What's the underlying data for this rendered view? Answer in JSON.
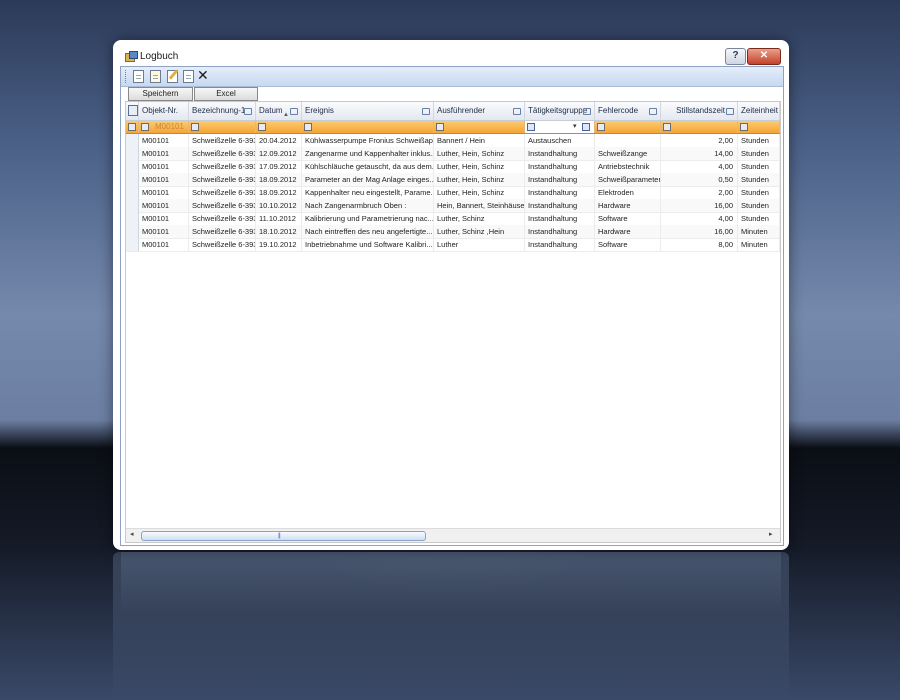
{
  "window": {
    "title": "Logbuch",
    "help_label": "?",
    "close_label": "✕"
  },
  "toolbar": {
    "icons": [
      "new-document-icon",
      "open-document-icon",
      "edit-document-icon",
      "blank-document-icon",
      "delete-icon"
    ],
    "delete_glyph": "✕"
  },
  "buttons": {
    "save_label": "Speichern",
    "excel_label": "Excel"
  },
  "grid": {
    "columns": [
      {
        "label": "Objekt-Nr."
      },
      {
        "label": "Bezeichnung-1"
      },
      {
        "label": "Datum"
      },
      {
        "label": "Ereignis"
      },
      {
        "label": "Ausführender"
      },
      {
        "label": "Tätigkeitsgruppe"
      },
      {
        "label": "Fehlercode"
      },
      {
        "label": "Stillstandszeit"
      },
      {
        "label": "Zeiteinheit"
      }
    ],
    "filter_ghost_text": "M00101",
    "rows": [
      {
        "objekt": "M00101",
        "bez": "Schweißzelle 6-393",
        "datum": "20.04.2012",
        "ereignis": "Kühlwasserpumpe Fronius Schweißap...",
        "ausf": "Bannert / Hein",
        "gruppe": "Austauschen",
        "fehler": "",
        "zeit": "2,00",
        "einheit": "Stunden"
      },
      {
        "objekt": "M00101",
        "bez": "Schweißzelle 6-393",
        "datum": "12.09.2012",
        "ereignis": "Zangenarme und Kappenhalter inklus...",
        "ausf": "Luther, Hein, Schinz",
        "gruppe": "Instandhaltung",
        "fehler": "Schweißzange",
        "zeit": "14,00",
        "einheit": "Stunden"
      },
      {
        "objekt": "M00101",
        "bez": "Schweißzelle 6-393",
        "datum": "17.09.2012",
        "ereignis": "Kühlschläuche getauscht, da aus dem...",
        "ausf": "Luther, Hein, Schinz",
        "gruppe": "Instandhaltung",
        "fehler": "Antriebstechnik",
        "zeit": "4,00",
        "einheit": "Stunden"
      },
      {
        "objekt": "M00101",
        "bez": "Schweißzelle 6-393",
        "datum": "18.09.2012",
        "ereignis": "Parameter an der Mag Anlage einges...",
        "ausf": "Luther, Hein, Schinz",
        "gruppe": "Instandhaltung",
        "fehler": "Schweißparameter",
        "zeit": "0,50",
        "einheit": "Stunden"
      },
      {
        "objekt": "M00101",
        "bez": "Schweißzelle 6-393",
        "datum": "18.09.2012",
        "ereignis": "Kappenhalter neu eingestellt, Parame...",
        "ausf": "Luther, Hein, Schinz",
        "gruppe": "Instandhaltung",
        "fehler": "Elektroden",
        "zeit": "2,00",
        "einheit": "Stunden"
      },
      {
        "objekt": "M00101",
        "bez": "Schweißzelle 6-393",
        "datum": "10.10.2012",
        "ereignis": "Nach Zangenarmbruch Oben :",
        "ausf": "Hein, Bannert, Steinhäuser",
        "gruppe": "Instandhaltung",
        "fehler": "Hardware",
        "zeit": "16,00",
        "einheit": "Stunden"
      },
      {
        "objekt": "M00101",
        "bez": "Schweißzelle 6-393",
        "datum": "11.10.2012",
        "ereignis": "Kalibrierung und Parametrierung nac...",
        "ausf": "Luther, Schinz",
        "gruppe": "Instandhaltung",
        "fehler": "Software",
        "zeit": "4,00",
        "einheit": "Stunden"
      },
      {
        "objekt": "M00101",
        "bez": "Schweißzelle 6-393",
        "datum": "18.10.2012",
        "ereignis": "Nach eintreffen des neu angefertigte...",
        "ausf": "Luther, Schinz ,Hein",
        "gruppe": "Instandhaltung",
        "fehler": "Hardware",
        "zeit": "16,00",
        "einheit": "Minuten"
      },
      {
        "objekt": "M00101",
        "bez": "Schweißzelle 6-393",
        "datum": "19.10.2012",
        "ereignis": "Inbetriebnahme und Software Kalibri...",
        "ausf": "Luther",
        "gruppe": "Instandhaltung",
        "fehler": "Software",
        "zeit": "8,00",
        "einheit": "Minuten"
      }
    ]
  },
  "scrollbar": {
    "left_arrow": "◂",
    "right_arrow": "▸",
    "grip": "|||"
  },
  "colors": {
    "filter_row": "#f6a436",
    "header_bg": "#e3e8f0",
    "toolstrip_bg": "#c7d8f0"
  }
}
